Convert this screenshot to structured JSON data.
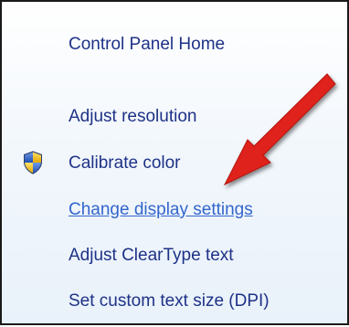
{
  "task_pane": {
    "home_link": "Control Panel Home",
    "items": [
      {
        "label": "Adjust resolution",
        "icon": null
      },
      {
        "label": "Calibrate color",
        "icon": "uac-shield-icon"
      },
      {
        "label": "Change display settings",
        "icon": null,
        "state": "hover"
      },
      {
        "label": "Adjust ClearType text",
        "icon": null
      },
      {
        "label": "Set custom text size (DPI)",
        "icon": null
      }
    ]
  },
  "annotation": {
    "type": "arrow",
    "color": "#e0231a",
    "points_to": "Change display settings"
  }
}
